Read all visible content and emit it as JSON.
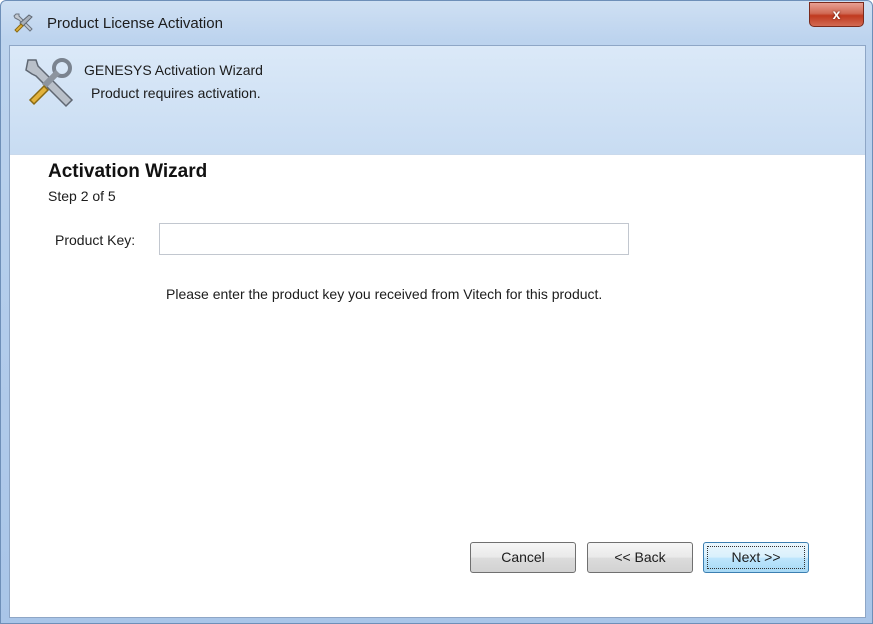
{
  "window": {
    "title": "Product License Activation",
    "close_label": "x"
  },
  "banner": {
    "title": "GENESYS Activation Wizard",
    "subtitle": "Product requires activation."
  },
  "wizard": {
    "heading": "Activation Wizard",
    "step": "Step 2 of 5",
    "product_key_label": "Product Key:",
    "product_key_value": "",
    "hint": "Please enter the product key you received from Vitech for this product."
  },
  "buttons": {
    "cancel": "Cancel",
    "back": "<< Back",
    "next": "Next >>"
  },
  "icons": {
    "app": "tools-icon",
    "close": "close-icon"
  }
}
